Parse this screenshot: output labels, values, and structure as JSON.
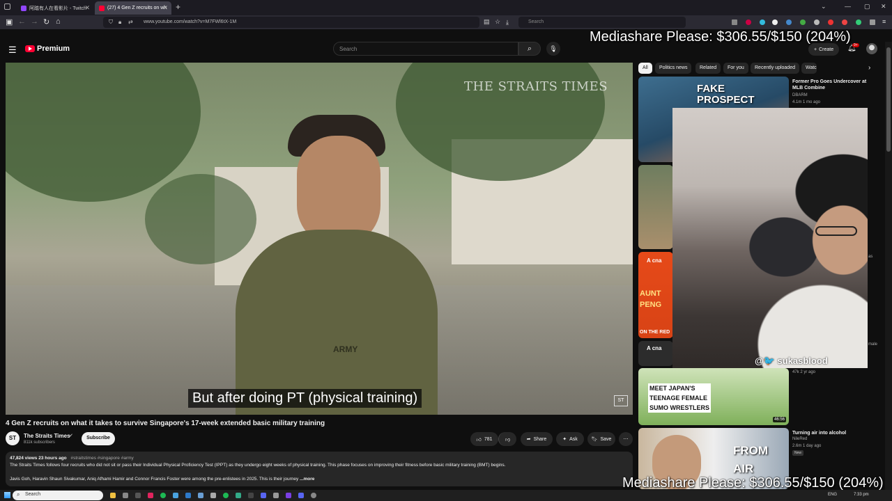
{
  "browser": {
    "tabs": [
      {
        "label": "阿踏有人在看影片 - Twitch",
        "favicon_color": "#9146ff"
      },
      {
        "label": "(27) 4 Gen Z recruits on wh",
        "favicon_color": "#ff0033"
      }
    ],
    "new_tab": "+",
    "url": "www.youtube.com/watch?v=M7FWl6tX-1M",
    "search_placeholder": "Search",
    "window_controls": [
      "⌄",
      "—",
      "▢",
      "✕"
    ]
  },
  "overlays": {
    "mediashare_top": "Mediashare Please: $306.55/$150 (204%)",
    "mediashare_bottom": "Mediashare Please: $306.55/$150 (204%)"
  },
  "youtube": {
    "logo_text": "Premium",
    "search_placeholder": "Search",
    "create_label": "Create",
    "notification_count": "9+"
  },
  "video": {
    "watermark": "THE STRAITS TIMES",
    "caption": "But after doing PT (physical training)",
    "corner_badge": "ST",
    "title": "4 Gen Z recruits on what it takes to survive Singapore's 17-week extended basic military training"
  },
  "channel": {
    "avatar_text": "ST",
    "name": "The Straits Times",
    "subscribers": "811k subscribers",
    "subscribe_label": "Subscribe"
  },
  "actions": {
    "likes": "781",
    "share": "Share",
    "ask": "Ask",
    "save": "Save",
    "more": "⋯"
  },
  "description": {
    "meta": "47,824 views  23 hours ago",
    "tags": "#straitstimes #singapore #army",
    "line1": "The Straits Times follows four recruits who did not sit or pass their Individual Physical Proficiency Test (IPPT) as they undergo eight weeks of physical training. This phase focuses on improving their fitness before basic military training (BMT) begins.",
    "line2": "Javis Goh, Haravin Shaun Sivakumar, Aniq Afhami Hamir and Connor Francis Foster were among the pre-enlistees in 2025. This is their journey",
    "more": "...more"
  },
  "chips": [
    "All",
    "Politics news",
    "Related",
    "For you",
    "Recently uploaded",
    "Watc"
  ],
  "related": [
    {
      "thumb_text": "FAKE PROSPECT",
      "title": "Former Pro Goes Undercover at MLB Combine",
      "channel": "DBARM",
      "meta": "4.1m  1 mo ago"
    },
    {
      "thumb_text": "",
      "title": "",
      "channel": "",
      "meta": "47k  2 yr ago"
    },
    {
      "thumb_text": "MEET JAPAN'S TEENAGE FEMALE SUMO WRESTLERS",
      "duration": "46:56"
    },
    {
      "thumb_text": "FROM AIR",
      "title": "Turning air into alcohol",
      "channel": "NileRed",
      "meta": "2.6m  1 day ago",
      "badge": "New"
    }
  ],
  "side_fragments": {
    "cna_1": "A cna",
    "aunt": "AUNT PENG",
    "on_the_red": "ON THE RED",
    "cna_2": "A cna",
    "right_as": "as",
    "right_male": "male"
  },
  "webcam": {
    "handle": "@🐦 sukasblood"
  },
  "taskbar": {
    "search_label": "Search",
    "tray": "ENG",
    "time": "7:33 pm"
  }
}
